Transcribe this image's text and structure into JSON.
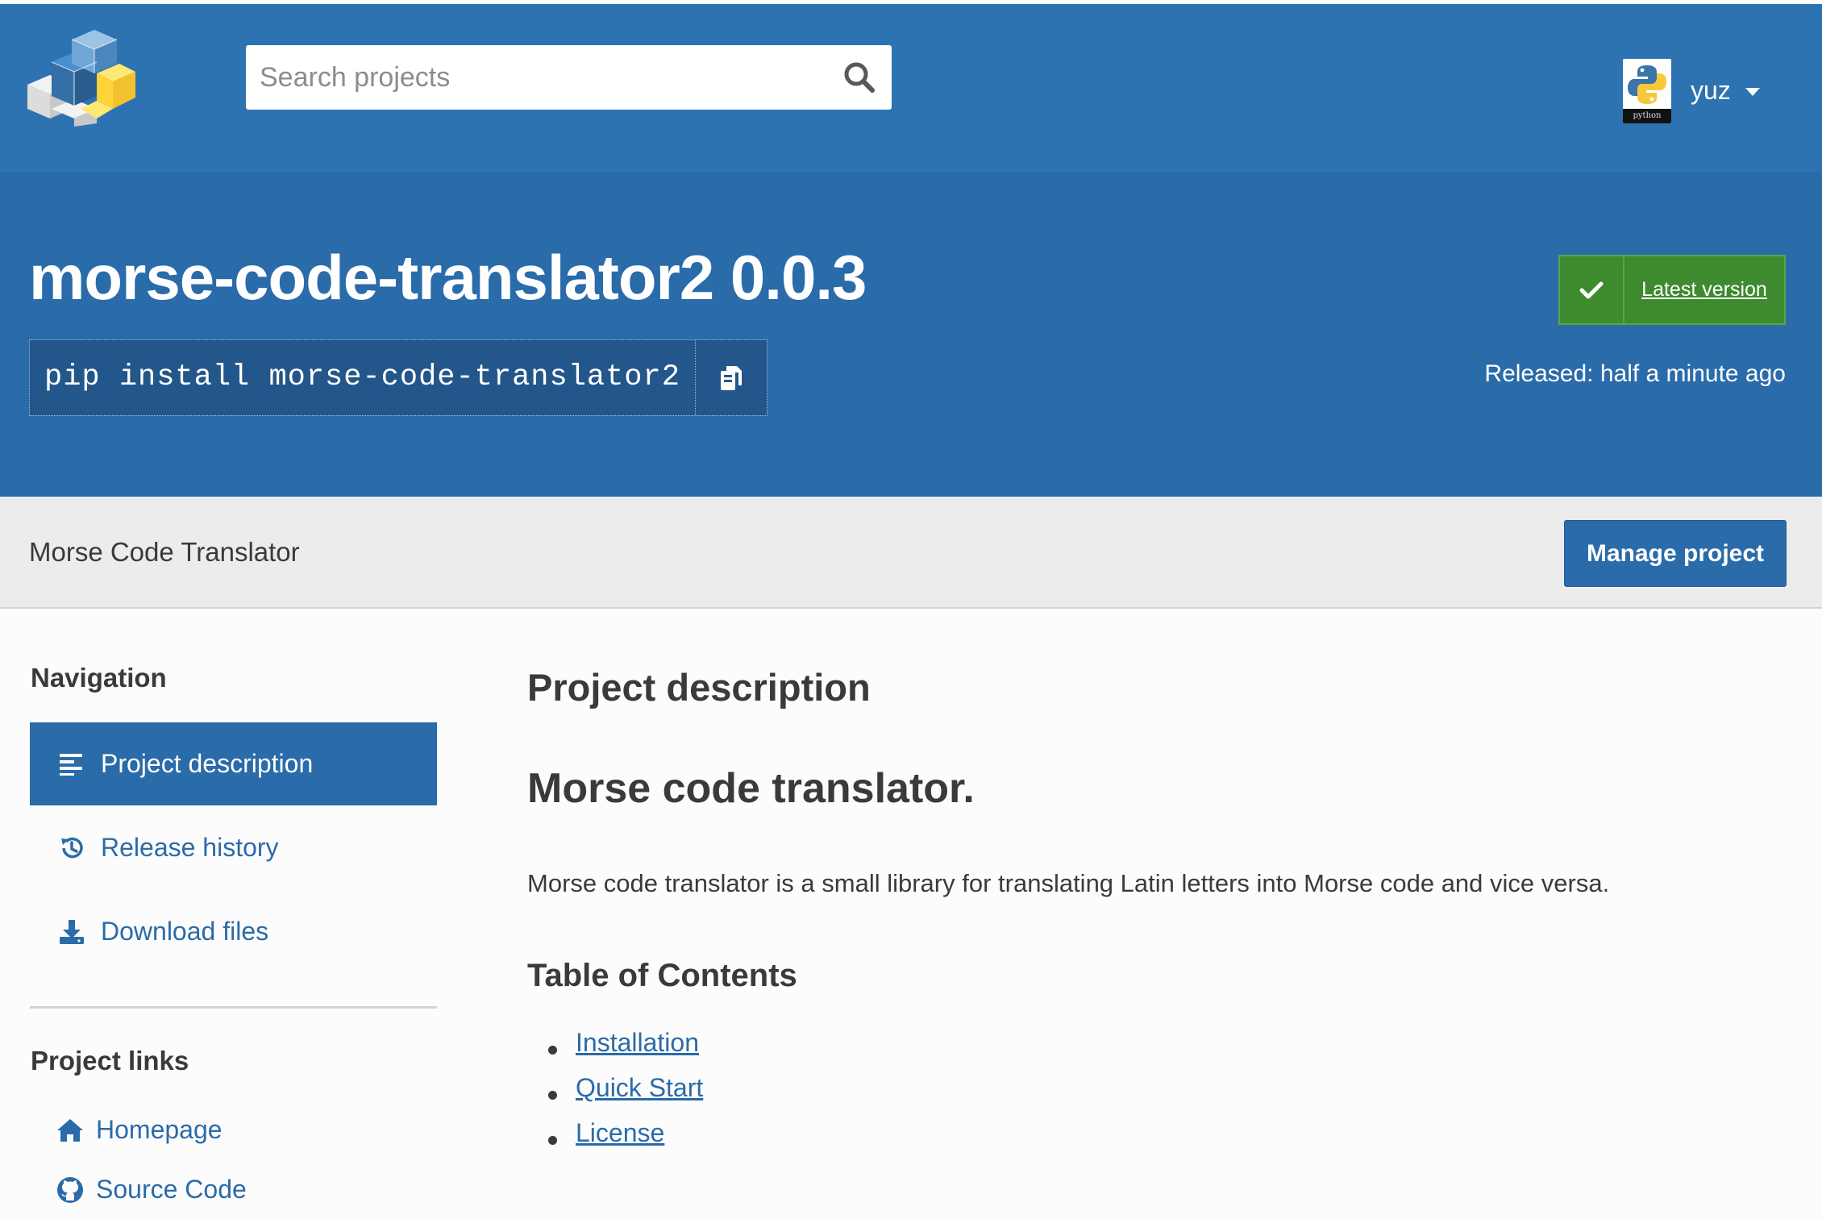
{
  "header": {
    "search": {
      "placeholder": "Search projects",
      "value": ""
    },
    "user": {
      "name": "yuz",
      "avatar_caption": "python"
    }
  },
  "package": {
    "title": "morse-code-translator2 0.0.3",
    "pip_command": "pip install morse-code-translator2",
    "latest_label": "Latest version",
    "released": "Released: half a minute ago"
  },
  "subheader": {
    "summary": "Morse Code Translator",
    "manage_label": "Manage project"
  },
  "sidebar": {
    "navigation_heading": "Navigation",
    "nav_items": [
      {
        "label": "Project description",
        "icon": "align-left-icon",
        "active": true
      },
      {
        "label": "Release history",
        "icon": "history-icon",
        "active": false
      },
      {
        "label": "Download files",
        "icon": "download-icon",
        "active": false
      }
    ],
    "links_heading": "Project links",
    "links": [
      {
        "label": "Homepage",
        "icon": "home-icon"
      },
      {
        "label": "Source Code",
        "icon": "github-icon"
      }
    ]
  },
  "main": {
    "section_title": "Project description",
    "readme": {
      "h1": "Morse code translator.",
      "paragraph": "Morse code translator is a small library for translating Latin letters into Morse code and vice versa.",
      "toc_heading": "Table of Contents",
      "toc": [
        "Installation",
        "Quick Start",
        "License"
      ]
    }
  },
  "colors": {
    "header_blue": "#2e73b1",
    "banner_blue": "#2a6ba9",
    "latest_green": "#3e8a2f",
    "link_blue": "#2a6ba9",
    "subbar_gray": "#ececec"
  }
}
